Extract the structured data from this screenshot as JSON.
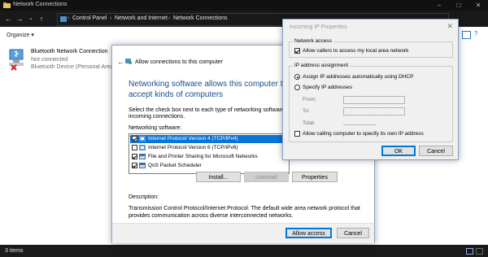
{
  "window": {
    "title": "Network Connections"
  },
  "address": {
    "crumbs": [
      "Control Panel",
      "Network and Internet",
      "Network Connections"
    ]
  },
  "toolbar": {
    "organize": "Organize ▾"
  },
  "connection": {
    "name": "Bluetooth Network Connection",
    "status": "Not connected",
    "device": "Bluetooth Device (Personal Area ..."
  },
  "status_bar": {
    "count": "3 items"
  },
  "allow_dialog": {
    "header": "Allow connections to this computer",
    "heading": "Networking software allows this computer to accept kinds of computers",
    "instruction_1": "Select the check box next to each type of networking software that s",
    "instruction_2": "incoming connections.",
    "software_label": "Networking software:",
    "items": [
      {
        "label": "Internet Protocol Version 4 (TCP/IPv4)",
        "checked": true,
        "selected": true
      },
      {
        "label": "Internet Protocol Version 6 (TCP/IPv6)",
        "checked": false,
        "selected": false
      },
      {
        "label": "File and Printer Sharing for Microsoft Networks",
        "checked": true,
        "selected": false
      },
      {
        "label": "QoS Packet Scheduler",
        "checked": true,
        "selected": false
      }
    ],
    "install_label": "Install...",
    "uninstall_label": "Uninstall",
    "properties_label": "Properties",
    "description_label": "Description:",
    "description_text": "Transmission Control Protocol/Internet Protocol. The default wide area network protocol that provides communication across diverse interconnected networks.",
    "allow_access_label": "Allow access",
    "cancel_label": "Cancel"
  },
  "ip_dialog": {
    "title": "Incoming IP Properties",
    "network_access_group": "Network access",
    "allow_callers_label": "Allow callers to access my local area network",
    "ip_group": "IP address assignment",
    "dhcp_label": "Assign IP addresses automatically using DHCP",
    "specify_label": "Specify IP addresses",
    "from_label": "From:",
    "to_label": "To:",
    "total_label": "Total:",
    "ip_placeholder": ". . .",
    "allow_specify_label": "Allow calling computer to specify its own IP address",
    "ok_label": "OK",
    "cancel_label": "Cancel"
  }
}
